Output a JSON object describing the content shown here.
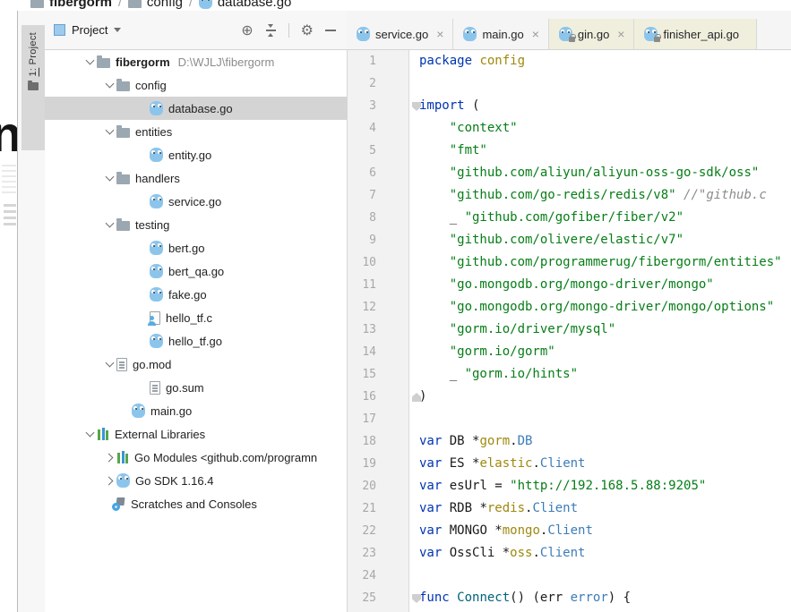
{
  "colors": {
    "keyword": "#0033B3",
    "string": "#067D17",
    "comment": "#8C8C8C",
    "package_name": "#9E880D",
    "type_name": "#3C7CB8",
    "function_name": "#00627A",
    "plain_code": "#1A1A1A",
    "library_tab_bg": "#F0EFDE",
    "selected_row_bg": "#D4D4D4",
    "gutter_bg": "#F2F2F2",
    "line_number": "#A8A8A8",
    "go_icon_blue": "#8CC5EC",
    "folder_icon": "#9BA7B1"
  },
  "navbar": {
    "separator": "/",
    "items": [
      {
        "label": "fibergorm",
        "icon": "folder",
        "bold": true
      },
      {
        "label": "config",
        "icon": "folder",
        "bold": false
      },
      {
        "label": "database.go",
        "icon": "go",
        "bold": false
      }
    ]
  },
  "tool_stripe": {
    "button_label": "1: Project",
    "stray_letter": "n"
  },
  "project_panel": {
    "header": {
      "title": "Project"
    },
    "tree": [
      {
        "label": "fibergorm",
        "secondary": "D:\\WJLJ\\fibergorm",
        "icon": "folder",
        "depth": 0,
        "chevron": "open",
        "bold": true,
        "selected": false
      },
      {
        "label": "config",
        "icon": "folder",
        "depth": 1,
        "chevron": "open",
        "selected": false
      },
      {
        "label": "database.go",
        "icon": "go",
        "depth": 2,
        "chevron": "none",
        "selected": true
      },
      {
        "label": "entities",
        "icon": "folder",
        "depth": 1,
        "chevron": "open",
        "selected": false
      },
      {
        "label": "entity.go",
        "icon": "go",
        "depth": 2,
        "chevron": "none",
        "selected": false
      },
      {
        "label": "handlers",
        "icon": "folder",
        "depth": 1,
        "chevron": "open",
        "selected": false
      },
      {
        "label": "service.go",
        "icon": "go",
        "depth": 2,
        "chevron": "none",
        "selected": false
      },
      {
        "label": "testing",
        "icon": "folder",
        "depth": 1,
        "chevron": "open",
        "selected": false
      },
      {
        "label": "bert.go",
        "icon": "go",
        "depth": 2,
        "chevron": "none",
        "selected": false
      },
      {
        "label": "bert_qa.go",
        "icon": "go",
        "depth": 2,
        "chevron": "none",
        "selected": false
      },
      {
        "label": "fake.go",
        "icon": "go",
        "depth": 2,
        "chevron": "none",
        "selected": false
      },
      {
        "label": "hello_tf.c",
        "icon": "cfile",
        "depth": 2,
        "chevron": "none",
        "selected": false
      },
      {
        "label": "hello_tf.go",
        "icon": "go",
        "depth": 2,
        "chevron": "none",
        "selected": false
      },
      {
        "label": "go.mod",
        "icon": "file",
        "depth": 1,
        "chevron": "open",
        "selected": false
      },
      {
        "label": "go.sum",
        "icon": "file",
        "depth": 2,
        "chevron": "none",
        "selected": false
      },
      {
        "label": "main.go",
        "icon": "go",
        "depth": 1,
        "chevron": "none",
        "pad": 97,
        "selected": false
      },
      {
        "label": "External Libraries",
        "icon": "lib",
        "depth": 0,
        "chevron": "open",
        "selected": false
      },
      {
        "label": "Go Modules <github.com/programn",
        "icon": "lib",
        "depth": 1,
        "chevron": "closed",
        "selected": false
      },
      {
        "label": "Go SDK 1.16.4",
        "icon": "go",
        "depth": 1,
        "chevron": "closed",
        "selected": false
      },
      {
        "label": "Scratches and Consoles",
        "icon": "scratch",
        "depth": 1,
        "chevron": "none",
        "pad": 75,
        "selected": false
      }
    ]
  },
  "editor_tabs": [
    {
      "label": "service.go",
      "icon": "go",
      "lock": false,
      "library": false,
      "close": true
    },
    {
      "label": "main.go",
      "icon": "go",
      "lock": false,
      "library": false,
      "close": true
    },
    {
      "label": "gin.go",
      "icon": "go",
      "lock": true,
      "library": true,
      "close": true
    },
    {
      "label": "finisher_api.go",
      "icon": "go",
      "lock": true,
      "library": true,
      "close": false
    }
  ],
  "editor": {
    "folds": [
      {
        "line": 3,
        "dir": "down"
      },
      {
        "line": 16,
        "dir": "up"
      },
      {
        "line": 25,
        "dir": "down"
      }
    ],
    "lines": [
      {
        "n": 1,
        "s": [
          [
            "package",
            "kw"
          ],
          [
            " ",
            "pl"
          ],
          [
            "config",
            "pkg"
          ]
        ]
      },
      {
        "n": 2,
        "s": []
      },
      {
        "n": 3,
        "s": [
          [
            "import",
            "kw"
          ],
          [
            " (",
            "pl"
          ]
        ]
      },
      {
        "n": 4,
        "s": [
          [
            "    ",
            "pl"
          ],
          [
            "\"context\"",
            "str"
          ]
        ]
      },
      {
        "n": 5,
        "s": [
          [
            "    ",
            "pl"
          ],
          [
            "\"fmt\"",
            "str"
          ]
        ]
      },
      {
        "n": 6,
        "s": [
          [
            "    ",
            "pl"
          ],
          [
            "\"github.com/aliyun/aliyun-oss-go-sdk/oss\"",
            "str"
          ]
        ]
      },
      {
        "n": 7,
        "s": [
          [
            "    ",
            "pl"
          ],
          [
            "\"github.com/go-redis/redis/v8\"",
            "str"
          ],
          [
            " ",
            "pl"
          ],
          [
            "//\"github.c",
            "cmt"
          ]
        ]
      },
      {
        "n": 8,
        "s": [
          [
            "    _ ",
            "pl"
          ],
          [
            "\"github.com/gofiber/fiber/v2\"",
            "str"
          ]
        ]
      },
      {
        "n": 9,
        "s": [
          [
            "    ",
            "pl"
          ],
          [
            "\"github.com/olivere/elastic/v7\"",
            "str"
          ]
        ]
      },
      {
        "n": 10,
        "s": [
          [
            "    ",
            "pl"
          ],
          [
            "\"github.com/programmerug/fibergorm/entities\"",
            "str"
          ]
        ]
      },
      {
        "n": 11,
        "s": [
          [
            "    ",
            "pl"
          ],
          [
            "\"go.mongodb.org/mongo-driver/mongo\"",
            "str"
          ]
        ]
      },
      {
        "n": 12,
        "s": [
          [
            "    ",
            "pl"
          ],
          [
            "\"go.mongodb.org/mongo-driver/mongo/options\"",
            "str"
          ]
        ]
      },
      {
        "n": 13,
        "s": [
          [
            "    ",
            "pl"
          ],
          [
            "\"gorm.io/driver/mysql\"",
            "str"
          ]
        ]
      },
      {
        "n": 14,
        "s": [
          [
            "    ",
            "pl"
          ],
          [
            "\"gorm.io/gorm\"",
            "str"
          ]
        ]
      },
      {
        "n": 15,
        "s": [
          [
            "    _ ",
            "pl"
          ],
          [
            "\"gorm.io/hints\"",
            "str"
          ]
        ]
      },
      {
        "n": 16,
        "s": [
          [
            ")",
            "pl"
          ]
        ]
      },
      {
        "n": 17,
        "s": []
      },
      {
        "n": 18,
        "s": [
          [
            "var",
            "kw"
          ],
          [
            " DB *",
            "pl"
          ],
          [
            "gorm",
            "pkg"
          ],
          [
            ".",
            "pl"
          ],
          [
            "DB",
            "typ"
          ]
        ]
      },
      {
        "n": 19,
        "s": [
          [
            "var",
            "kw"
          ],
          [
            " ES *",
            "pl"
          ],
          [
            "elastic",
            "pkg"
          ],
          [
            ".",
            "pl"
          ],
          [
            "Client",
            "typ"
          ]
        ]
      },
      {
        "n": 20,
        "s": [
          [
            "var",
            "kw"
          ],
          [
            " esUrl = ",
            "pl"
          ],
          [
            "\"http://192.168.5.88:9205\"",
            "str"
          ]
        ]
      },
      {
        "n": 21,
        "s": [
          [
            "var",
            "kw"
          ],
          [
            " RDB *",
            "pl"
          ],
          [
            "redis",
            "pkg"
          ],
          [
            ".",
            "pl"
          ],
          [
            "Client",
            "typ"
          ]
        ]
      },
      {
        "n": 22,
        "s": [
          [
            "var",
            "kw"
          ],
          [
            " MONGO *",
            "pl"
          ],
          [
            "mongo",
            "pkg"
          ],
          [
            ".",
            "pl"
          ],
          [
            "Client",
            "typ"
          ]
        ]
      },
      {
        "n": 23,
        "s": [
          [
            "var",
            "kw"
          ],
          [
            " OssCli *",
            "pl"
          ],
          [
            "oss",
            "pkg"
          ],
          [
            ".",
            "pl"
          ],
          [
            "Client",
            "typ"
          ]
        ]
      },
      {
        "n": 24,
        "s": []
      },
      {
        "n": 25,
        "s": [
          [
            "func",
            "kw"
          ],
          [
            " ",
            "pl"
          ],
          [
            "Connect",
            "fn"
          ],
          [
            "() (err ",
            "pl"
          ],
          [
            "error",
            "typ"
          ],
          [
            ") {",
            "pl"
          ]
        ]
      }
    ]
  }
}
